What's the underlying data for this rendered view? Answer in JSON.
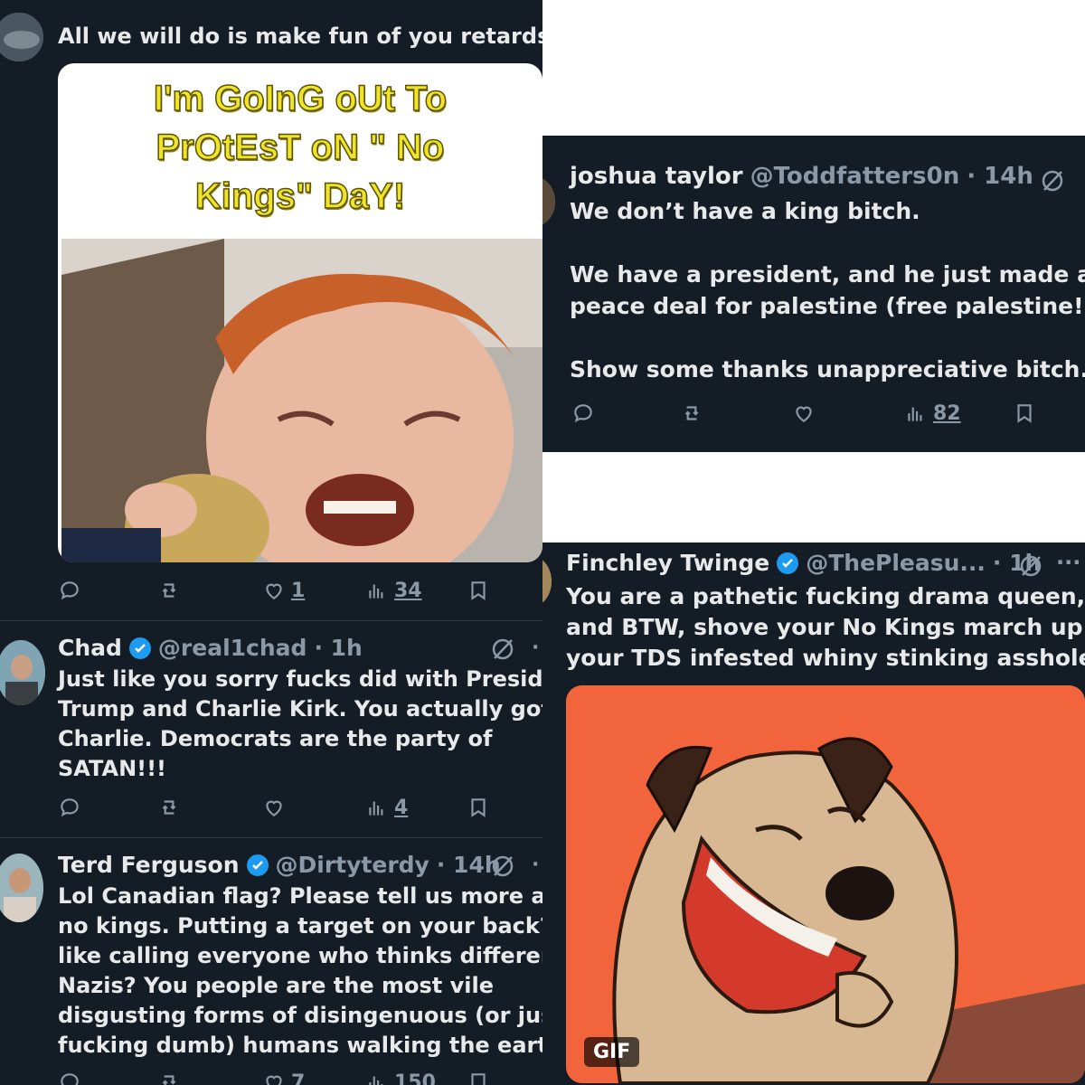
{
  "left": {
    "tweet1": {
      "text": "All we will do is make fun of you retards",
      "meme_caption_lines": [
        "I'm GoInG oUt To",
        "PrOtEsT oN \" No",
        "Kings\" DaY!"
      ],
      "actions": {
        "likes": "1",
        "views": "34"
      }
    },
    "tweet2": {
      "name": "Chad",
      "handle": "@real1chad",
      "time": "· 1h",
      "text_lines": [
        "Just like  you sorry fucks did with President",
        "Trump and Charlie Kirk. You actually got",
        "Charlie. Democrats are the party of",
        "SATAN!!!"
      ],
      "actions": {
        "views": "4"
      }
    },
    "tweet3": {
      "name": "Terd Ferguson",
      "handle": "@Dirtyterdy",
      "time": "· 14h",
      "text_lines": [
        "Lol Canadian flag? Please tell us more abou",
        "no kings. Putting a target on your back? Oh",
        "like calling everyone who thinks differently",
        "Nazis? You people are the most vile",
        "disgusting forms of disingenuous (or just",
        "fucking dumb) humans walking the earth"
      ],
      "actions": {
        "likes": "7",
        "views": "150"
      }
    }
  },
  "right_top": {
    "name": "joshua taylor",
    "handle": "@Toddfatters0n",
    "time": "· 14h",
    "text_lines": [
      "We don’t have a king bitch.",
      "",
      "We have a president, and he just made a",
      "peace deal for palestine (free palestine!!!!)",
      "",
      "Show some thanks unappreciative bitch."
    ],
    "actions": {
      "views": "82"
    }
  },
  "right_bottom": {
    "name": "Finchley Twinge",
    "handle": "@ThePleasu...",
    "time": "· 1h",
    "more": "···",
    "text_lines": [
      "You are a pathetic fucking drama queen, oh",
      "and BTW, shove your No Kings march up",
      "your TDS infested whiny stinking  asshole."
    ],
    "gif_label": "GIF"
  },
  "colors": {
    "background": "#141d26",
    "text": "#e7e9ea",
    "muted": "#8b98a5",
    "verified": "#1d9bf0",
    "meme_text": "#f0e42a",
    "gif_background": "#f2643b"
  },
  "icons": [
    "reply-icon",
    "retweet-icon",
    "like-icon",
    "views-icon",
    "bookmark-icon",
    "grok-icon",
    "verified-badge-icon"
  ]
}
